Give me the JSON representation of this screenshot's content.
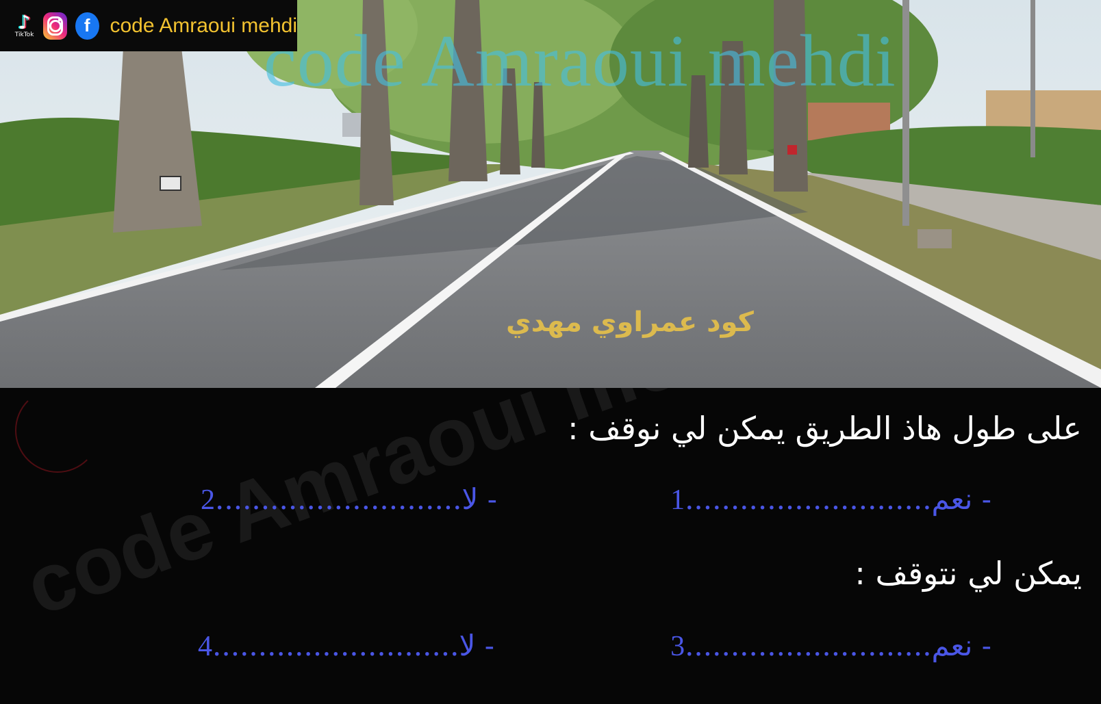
{
  "social": {
    "tiktok_label": "TikTok",
    "tiktok_glyph": "♪",
    "facebook_glyph": "f",
    "brand_text": "code Amraoui mehdi"
  },
  "overlay": {
    "watermark_top": "code Amraoui mehdi",
    "watermark_bottom": "code Amraoui mehdi",
    "caption_arabic": "كود عمراوي مهدي"
  },
  "quiz": {
    "q1": "على طول هاذ الطريق يمكن لي نوقف :",
    "q1_answers": [
      {
        "text": "- نعم",
        "dots": "...........................",
        "num": "1"
      },
      {
        "text": "- لا",
        "dots": "...........................",
        "num": "2"
      }
    ],
    "q2": "يمكن لي نتوقف :",
    "q2_answers": [
      {
        "text": "- نعم",
        "dots": "...........................",
        "num": "3"
      },
      {
        "text": "- لا",
        "dots": "...........................",
        "num": "4"
      }
    ]
  },
  "colors": {
    "brand_yellow": "#f2c230",
    "answer_blue": "#4a56e6",
    "watermark_cyan": "#46bee1"
  }
}
